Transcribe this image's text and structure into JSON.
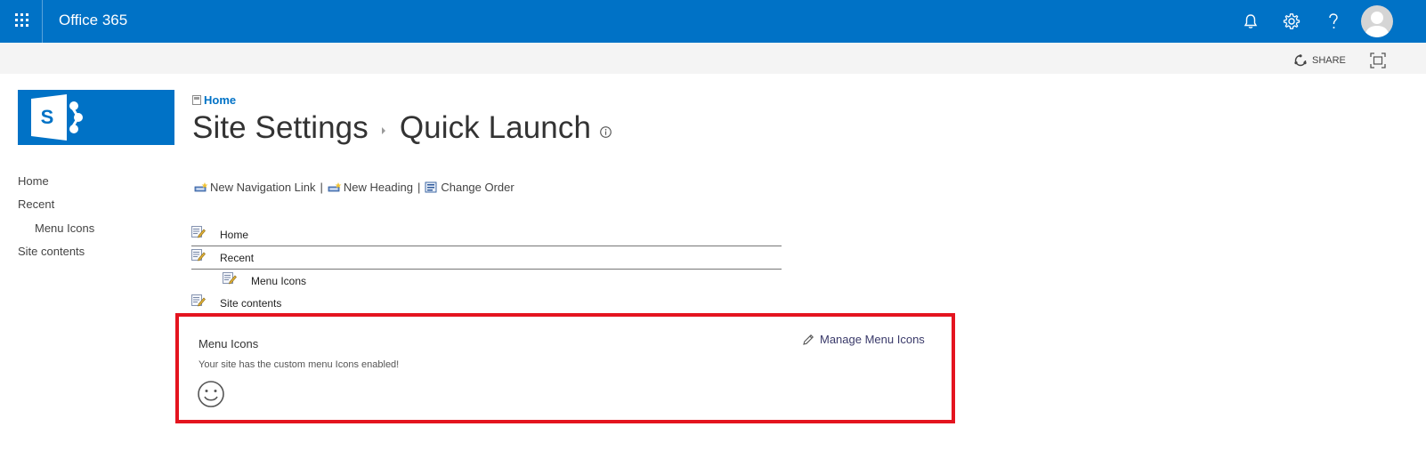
{
  "suitebar": {
    "brand": "Office 365",
    "color": "#0072c6"
  },
  "ribbon": {
    "share_label": "SHARE"
  },
  "breadcrumb": {
    "label": "Home"
  },
  "title": {
    "part1": "Site Settings",
    "part2": "Quick Launch"
  },
  "leftnav": {
    "items": [
      {
        "label": "Home",
        "level": 0
      },
      {
        "label": "Recent",
        "level": 0
      },
      {
        "label": "Menu Icons",
        "level": 1
      },
      {
        "label": "Site contents",
        "level": 0
      }
    ]
  },
  "toolbar": {
    "new_link": "New Navigation Link",
    "separator": "|",
    "new_heading": "New Heading",
    "change_order": "Change Order"
  },
  "tree": {
    "items": [
      {
        "label": "Home"
      },
      {
        "label": "Recent"
      },
      {
        "label": "Menu Icons"
      },
      {
        "label": "Site contents"
      }
    ]
  },
  "panel": {
    "title": "Menu Icons",
    "message": "Your site has the custom menu Icons enabled!",
    "manage_label": "Manage Menu Icons",
    "border_color": "#e4141f"
  }
}
